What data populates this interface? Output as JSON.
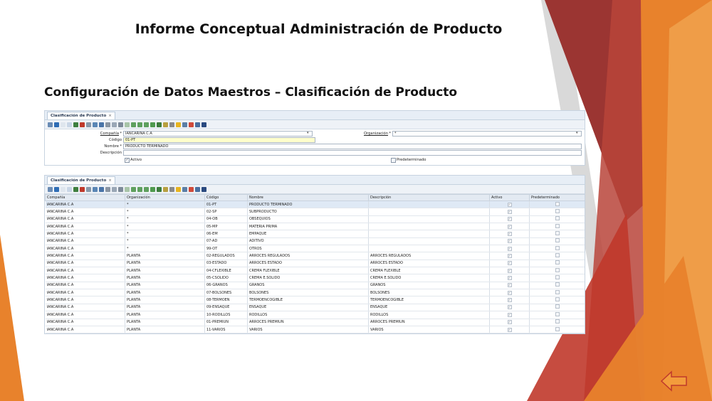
{
  "slide": {
    "title": "Informe Conceptual Administración de Producto",
    "subtitle": "Configuración de Datos Maestros – Clasificación de Producto"
  },
  "colors": {
    "dark_red": "#9b3532",
    "red": "#c0392b",
    "orange": "#e8822c",
    "light_orange": "#f39c3c",
    "grey": "#b5b5b5"
  },
  "form_window": {
    "tab_label": "Clasificación de Producto",
    "tab_close": "×",
    "fields": {
      "company_label": "Compañía",
      "company_value": "IANCARINA C.A",
      "organization_label": "Organización",
      "organization_value": "*",
      "code_label": "Código",
      "code_value": "01-PT",
      "name_label": "Nombre",
      "name_value": "PRODUCTO TERMINADO",
      "description_label": "Descripción",
      "description_value": "",
      "active_label": "Activo",
      "default_label": "Predeterminado"
    },
    "toolbar_icons": [
      "nav-icon",
      "help-icon",
      "new-icon",
      "copy-icon",
      "save-icon",
      "delete-icon",
      "print-icon",
      "refresh-icon",
      "find-icon",
      "attach-icon",
      "chat-icon",
      "history-icon",
      "first-icon",
      "prev-icon",
      "next-icon",
      "last-icon",
      "parent-icon",
      "detail-icon",
      "report-icon",
      "archive-icon",
      "lock-icon",
      "zoom-icon",
      "request-icon",
      "product-icon",
      "exit-icon"
    ]
  },
  "grid_window": {
    "tab_label": "Clasificación de Producto",
    "tab_close": "×",
    "columns": [
      "Compañía",
      "Organización",
      "Código",
      "Nombre",
      "Descripción",
      "Activo",
      "Predeterminado"
    ],
    "rows": [
      [
        "IANCARINA C.A",
        "*",
        "01-PT",
        "PRODUCTO TERMINADO",
        "",
        true,
        false
      ],
      [
        "IANCARINA C.A",
        "*",
        "02-SP",
        "SUBPRODUCTO",
        "",
        true,
        false
      ],
      [
        "IANCARINA C.A",
        "*",
        "04-OB",
        "OBSEQUIOS",
        "",
        true,
        false
      ],
      [
        "IANCARINA C.A",
        "*",
        "05-MP",
        "MATERIA PRIMA",
        "",
        true,
        false
      ],
      [
        "IANCARINA C.A",
        "*",
        "06-EM",
        "EMPAQUE",
        "",
        true,
        false
      ],
      [
        "IANCARINA C.A",
        "*",
        "07-AD",
        "ADITIVO",
        "",
        true,
        false
      ],
      [
        "IANCARINA C.A",
        "*",
        "99-OT",
        "OTROS",
        "",
        true,
        false
      ],
      [
        "IANCARINA C.A",
        "PLANTA",
        "02-REGULADOS",
        "ARROCES REGULADOS",
        "ARROCES REGULADOS",
        true,
        false
      ],
      [
        "IANCARINA C.A",
        "PLANTA",
        "03-ESTADO",
        "ARROCES ESTADO",
        "ARROCES ESTADO",
        true,
        false
      ],
      [
        "IANCARINA C.A",
        "PLANTA",
        "04-CFLEXIBLE",
        "CREMA FLEXIBLE",
        "CREMA FLEXIBLE",
        true,
        false
      ],
      [
        "IANCARINA C.A",
        "PLANTA",
        "05-CSOLIDO",
        "CREMA E.SOLIDO",
        "CREMA E.SOLIDO",
        true,
        false
      ],
      [
        "IANCARINA C.A",
        "PLANTA",
        "06-GRANOS",
        "GRANOS",
        "GRANOS",
        true,
        false
      ],
      [
        "IANCARINA C.A",
        "PLANTA",
        "07-BOLSONES",
        "BOLSONES",
        "BOLSONES",
        true,
        false
      ],
      [
        "IANCARINA C.A",
        "PLANTA",
        "08-TERMOEN",
        "TERMOENCOGIBLE",
        "TERMOENCOGIBLE",
        true,
        false
      ],
      [
        "IANCARINA C.A",
        "PLANTA",
        "09-ENSAQUE",
        "ENSAQUE",
        "ENSAQUE",
        true,
        false
      ],
      [
        "IANCARINA C.A",
        "PLANTA",
        "10-RODILLOS",
        "RODILLOS",
        "RODILLOS",
        true,
        false
      ],
      [
        "IANCARINA C.A",
        "PLANTA",
        "01-PREMIUN",
        "ARROCES PREMIUN",
        "ARROCES PREMIUN",
        true,
        false
      ],
      [
        "IANCARINA C.A",
        "PLANTA",
        "11-VARIOS",
        "VARIOS",
        "VARIOS",
        true,
        false
      ]
    ]
  }
}
